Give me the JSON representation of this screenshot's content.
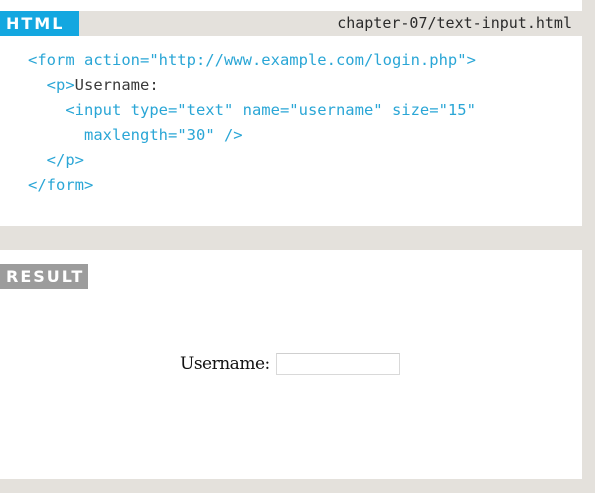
{
  "html_panel": {
    "tag": "HTML",
    "filename": "chapter-07/text-input.html",
    "code_lines": [
      {
        "indent": "",
        "parts": [
          {
            "t": "<form action=\"http://www.example.com/login.php\">",
            "c": "tag"
          }
        ]
      },
      {
        "indent": "  ",
        "parts": [
          {
            "t": "<p>",
            "c": "tag"
          },
          {
            "t": "Username:",
            "c": "plain"
          }
        ]
      },
      {
        "indent": "    ",
        "parts": [
          {
            "t": "<input type=\"text\" name=\"username\" size=\"15\"",
            "c": "tag"
          }
        ]
      },
      {
        "indent": "      ",
        "parts": [
          {
            "t": "maxlength=\"30\" />",
            "c": "tag"
          }
        ]
      },
      {
        "indent": "  ",
        "parts": [
          {
            "t": "</p>",
            "c": "tag"
          }
        ]
      },
      {
        "indent": "",
        "parts": [
          {
            "t": "</form>",
            "c": "tag"
          }
        ]
      }
    ]
  },
  "result_panel": {
    "tag": "RESULT",
    "label": "Username:",
    "input_value": ""
  },
  "colors": {
    "html_tag": "#13a7e0",
    "result_tag": "#9c9c9c",
    "code_tag": "#2aa6d6",
    "background": "#e4e1dc"
  }
}
